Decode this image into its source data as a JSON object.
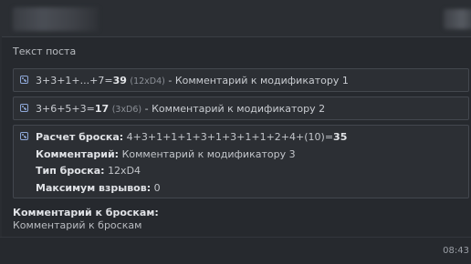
{
  "post": {
    "text": "Текст поста"
  },
  "rolls": [
    {
      "formula": "3+3+1+...+7=",
      "result": "39",
      "dice": "(12xD4)",
      "comment": " - Комментарий к модификатору 1"
    },
    {
      "formula": "3+6+5+3=",
      "result": "17",
      "dice": "(3xD6)",
      "comment": " - Комментарий к модификатору 2"
    }
  ],
  "detail": {
    "calc_label": "Расчет броска:",
    "calc_formula": "4+3+1+1+1+3+1+3+1+1+2+4+(10)=",
    "calc_result": "35",
    "comment_label": "Комментарий:",
    "comment_value": "Комментарий к модификатору 3",
    "type_label": "Тип броска:",
    "type_value": "12xD4",
    "explode_label": "Максимум взрывов:",
    "explode_value": "0"
  },
  "comments": {
    "label": "Комментарий к броскам:",
    "value": "Комментарий к броскам"
  },
  "footer": {
    "time": "08:43"
  },
  "colors": {
    "background": "#26292e",
    "box_border": "#43474e",
    "icon": "#8fa8d8"
  },
  "icons": {
    "roll": "dice-icon"
  }
}
